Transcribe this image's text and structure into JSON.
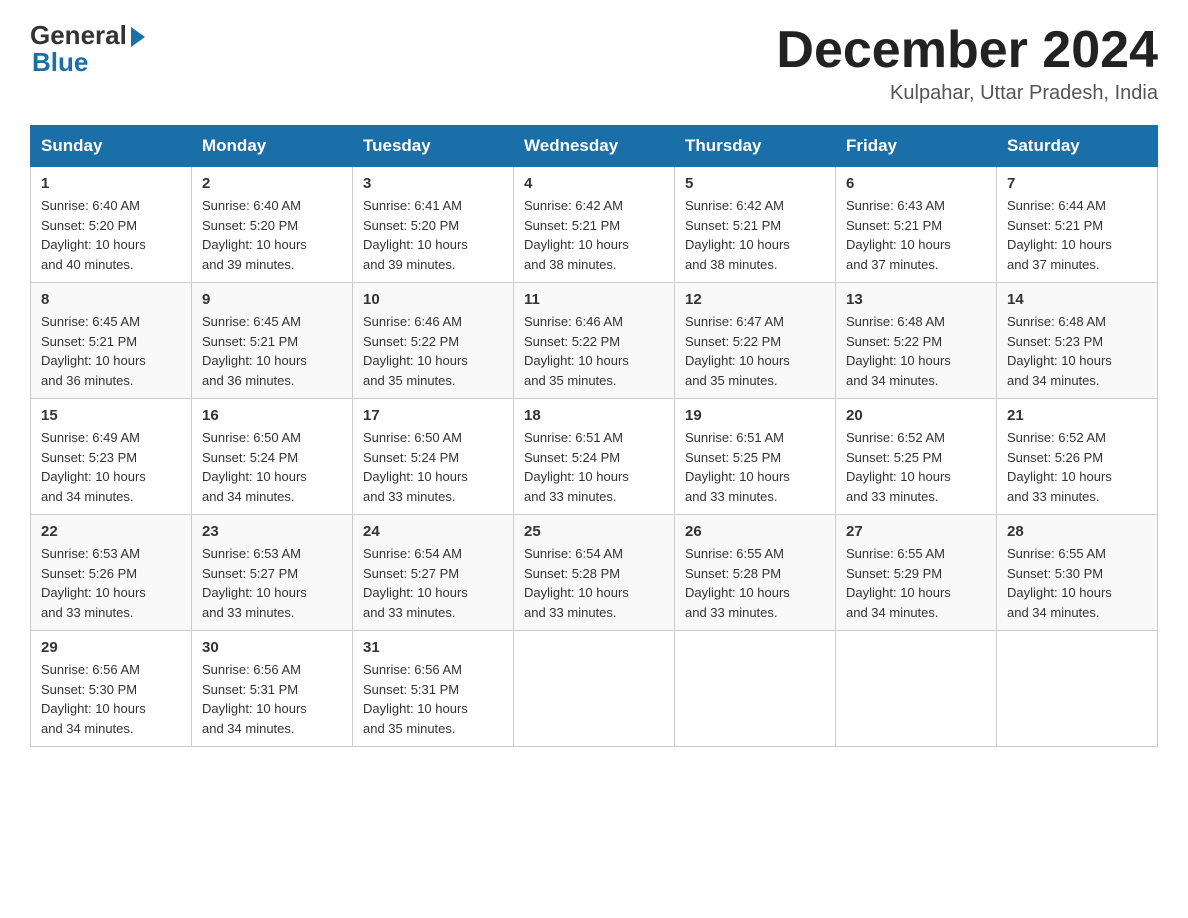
{
  "logo": {
    "general_text": "General",
    "blue_text": "Blue"
  },
  "title": "December 2024",
  "location": "Kulpahar, Uttar Pradesh, India",
  "days_of_week": [
    "Sunday",
    "Monday",
    "Tuesday",
    "Wednesday",
    "Thursday",
    "Friday",
    "Saturday"
  ],
  "weeks": [
    [
      {
        "day": "1",
        "sunrise": "6:40 AM",
        "sunset": "5:20 PM",
        "daylight": "10 hours and 40 minutes."
      },
      {
        "day": "2",
        "sunrise": "6:40 AM",
        "sunset": "5:20 PM",
        "daylight": "10 hours and 39 minutes."
      },
      {
        "day": "3",
        "sunrise": "6:41 AM",
        "sunset": "5:20 PM",
        "daylight": "10 hours and 39 minutes."
      },
      {
        "day": "4",
        "sunrise": "6:42 AM",
        "sunset": "5:21 PM",
        "daylight": "10 hours and 38 minutes."
      },
      {
        "day": "5",
        "sunrise": "6:42 AM",
        "sunset": "5:21 PM",
        "daylight": "10 hours and 38 minutes."
      },
      {
        "day": "6",
        "sunrise": "6:43 AM",
        "sunset": "5:21 PM",
        "daylight": "10 hours and 37 minutes."
      },
      {
        "day": "7",
        "sunrise": "6:44 AM",
        "sunset": "5:21 PM",
        "daylight": "10 hours and 37 minutes."
      }
    ],
    [
      {
        "day": "8",
        "sunrise": "6:45 AM",
        "sunset": "5:21 PM",
        "daylight": "10 hours and 36 minutes."
      },
      {
        "day": "9",
        "sunrise": "6:45 AM",
        "sunset": "5:21 PM",
        "daylight": "10 hours and 36 minutes."
      },
      {
        "day": "10",
        "sunrise": "6:46 AM",
        "sunset": "5:22 PM",
        "daylight": "10 hours and 35 minutes."
      },
      {
        "day": "11",
        "sunrise": "6:46 AM",
        "sunset": "5:22 PM",
        "daylight": "10 hours and 35 minutes."
      },
      {
        "day": "12",
        "sunrise": "6:47 AM",
        "sunset": "5:22 PM",
        "daylight": "10 hours and 35 minutes."
      },
      {
        "day": "13",
        "sunrise": "6:48 AM",
        "sunset": "5:22 PM",
        "daylight": "10 hours and 34 minutes."
      },
      {
        "day": "14",
        "sunrise": "6:48 AM",
        "sunset": "5:23 PM",
        "daylight": "10 hours and 34 minutes."
      }
    ],
    [
      {
        "day": "15",
        "sunrise": "6:49 AM",
        "sunset": "5:23 PM",
        "daylight": "10 hours and 34 minutes."
      },
      {
        "day": "16",
        "sunrise": "6:50 AM",
        "sunset": "5:24 PM",
        "daylight": "10 hours and 34 minutes."
      },
      {
        "day": "17",
        "sunrise": "6:50 AM",
        "sunset": "5:24 PM",
        "daylight": "10 hours and 33 minutes."
      },
      {
        "day": "18",
        "sunrise": "6:51 AM",
        "sunset": "5:24 PM",
        "daylight": "10 hours and 33 minutes."
      },
      {
        "day": "19",
        "sunrise": "6:51 AM",
        "sunset": "5:25 PM",
        "daylight": "10 hours and 33 minutes."
      },
      {
        "day": "20",
        "sunrise": "6:52 AM",
        "sunset": "5:25 PM",
        "daylight": "10 hours and 33 minutes."
      },
      {
        "day": "21",
        "sunrise": "6:52 AM",
        "sunset": "5:26 PM",
        "daylight": "10 hours and 33 minutes."
      }
    ],
    [
      {
        "day": "22",
        "sunrise": "6:53 AM",
        "sunset": "5:26 PM",
        "daylight": "10 hours and 33 minutes."
      },
      {
        "day": "23",
        "sunrise": "6:53 AM",
        "sunset": "5:27 PM",
        "daylight": "10 hours and 33 minutes."
      },
      {
        "day": "24",
        "sunrise": "6:54 AM",
        "sunset": "5:27 PM",
        "daylight": "10 hours and 33 minutes."
      },
      {
        "day": "25",
        "sunrise": "6:54 AM",
        "sunset": "5:28 PM",
        "daylight": "10 hours and 33 minutes."
      },
      {
        "day": "26",
        "sunrise": "6:55 AM",
        "sunset": "5:28 PM",
        "daylight": "10 hours and 33 minutes."
      },
      {
        "day": "27",
        "sunrise": "6:55 AM",
        "sunset": "5:29 PM",
        "daylight": "10 hours and 34 minutes."
      },
      {
        "day": "28",
        "sunrise": "6:55 AM",
        "sunset": "5:30 PM",
        "daylight": "10 hours and 34 minutes."
      }
    ],
    [
      {
        "day": "29",
        "sunrise": "6:56 AM",
        "sunset": "5:30 PM",
        "daylight": "10 hours and 34 minutes."
      },
      {
        "day": "30",
        "sunrise": "6:56 AM",
        "sunset": "5:31 PM",
        "daylight": "10 hours and 34 minutes."
      },
      {
        "day": "31",
        "sunrise": "6:56 AM",
        "sunset": "5:31 PM",
        "daylight": "10 hours and 35 minutes."
      },
      null,
      null,
      null,
      null
    ]
  ],
  "labels": {
    "sunrise": "Sunrise:",
    "sunset": "Sunset:",
    "daylight": "Daylight:"
  }
}
